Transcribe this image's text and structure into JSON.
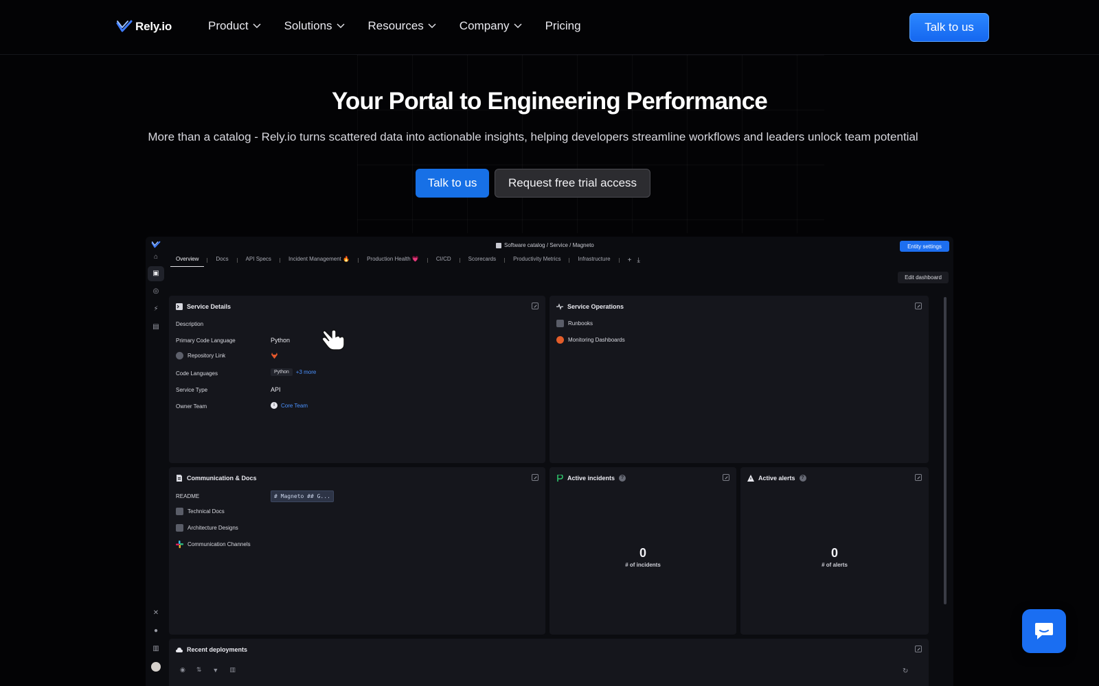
{
  "nav": {
    "brand": "Rely.io",
    "menu": [
      {
        "label": "Product",
        "dropdown": true
      },
      {
        "label": "Solutions",
        "dropdown": true
      },
      {
        "label": "Resources",
        "dropdown": true
      },
      {
        "label": "Company",
        "dropdown": true
      },
      {
        "label": "Pricing",
        "dropdown": false
      }
    ],
    "cta_label": "Talk to us"
  },
  "hero": {
    "title": "Your Portal to Engineering Performance",
    "subtitle": "More than a catalog - Rely.io turns scattered data into actionable insights, helping developers streamline workflows and leaders unlock team potential",
    "primary_cta": "Talk to us",
    "secondary_cta": "Request free trial access"
  },
  "app": {
    "breadcrumb": "Software catalog / Service / Magneto",
    "entity_settings": "Entity settings",
    "edit_dashboard": "Edit dashboard",
    "tabs": [
      "Overview",
      "Docs",
      "API Specs",
      "Incident Management 🔥",
      "Production Health 💗",
      "CI/CD",
      "Scorecards",
      "Productivity Metrics",
      "Infrastructure"
    ],
    "service_details": {
      "title": "Service Details",
      "description_label": "Description",
      "primary_language_label": "Primary Code Language",
      "primary_language": "Python",
      "repo_label": "Repository Link",
      "code_languages_label": "Code Languages",
      "code_language_chip": "Python",
      "more_languages": "+3 more",
      "service_type_label": "Service Type",
      "service_type": "API",
      "owner_team_label": "Owner Team",
      "owner_team": "Core Team"
    },
    "service_operations": {
      "title": "Service Operations",
      "items": [
        "Runbooks",
        "Monitoring Dashboards"
      ]
    },
    "comm_docs": {
      "title": "Communication & Docs",
      "readme_label": "README",
      "readme_preview": "# Magneto ## G...",
      "items": [
        "Technical Docs",
        "Architecture Designs",
        "Communication Channels"
      ]
    },
    "active_incidents": {
      "title": "Active incidents",
      "count": "0",
      "label": "# of incidents"
    },
    "active_alerts": {
      "title": "Active alerts",
      "count": "0",
      "label": "# of alerts"
    },
    "recent_deployments": {
      "title": "Recent deployments"
    }
  },
  "colors": {
    "accent": "#1770e6",
    "background": "#030305",
    "panel": "#15161c"
  }
}
